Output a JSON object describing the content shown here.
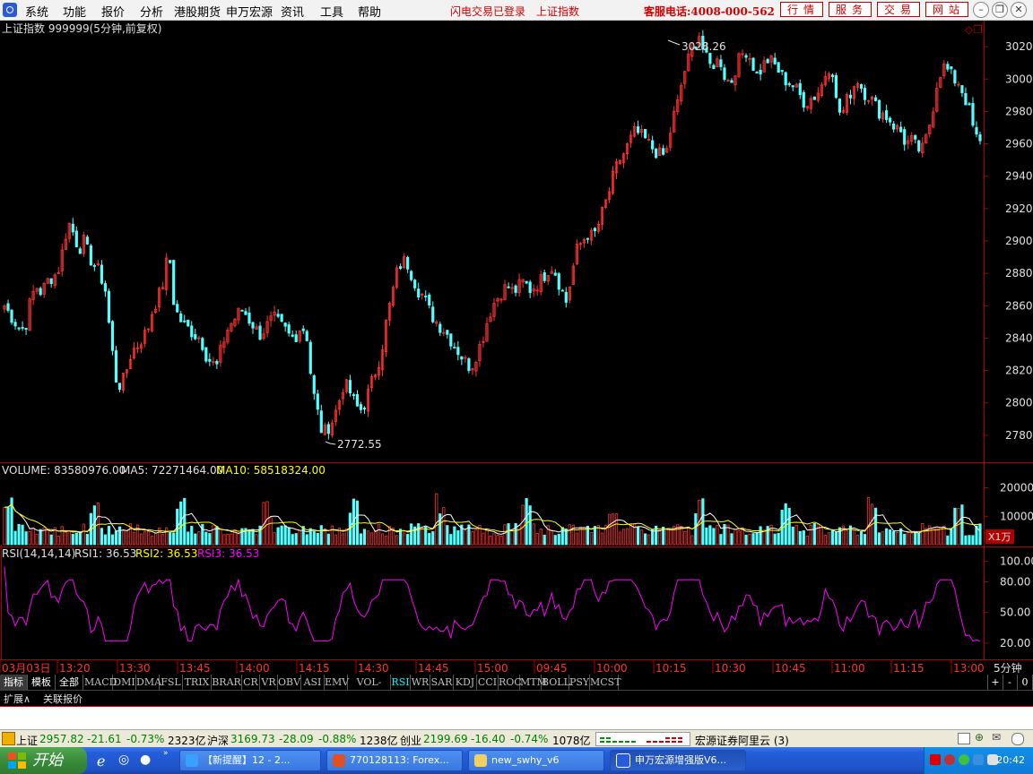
{
  "menu": {
    "items": [
      "系统",
      "功能",
      "报价",
      "分析",
      "港股期货",
      "申万宏源",
      "资讯",
      "工具",
      "帮助"
    ],
    "flash": "闪电交易已登录",
    "index_name": "上证指数",
    "hotline": "客服电话:4008-000-562",
    "right_buttons": [
      "行情",
      "服务",
      "交易",
      "网站"
    ]
  },
  "chart": {
    "header": "上证指数 999999(5分钟,前复权)",
    "high_label": "3028.26",
    "low_label": "2772.55",
    "price_ticks": [
      "3020",
      "3000",
      "2980",
      "2960",
      "2940",
      "2920",
      "2900",
      "2880",
      "2860",
      "2840",
      "2820",
      "2800",
      "2780"
    ],
    "volume_header": {
      "vol": "VOLUME: 83580976.00",
      "ma5": "MA5: 72271464.00",
      "ma10": "MA10: 58518324.00"
    },
    "volume_ticks": [
      "20000",
      "10000"
    ],
    "volume_unit": "X1万",
    "rsi_header": {
      "name": "RSI(14,14,14)",
      "rsi1": "RSI1: 36.53",
      "rsi2": "RSI2: 36.53",
      "rsi3": "RSI3: 36.53"
    },
    "rsi_ticks": [
      "100.00",
      "80.00",
      "50.00",
      "20.00"
    ],
    "time_labels": [
      "03月03日",
      "13:20",
      "13:30",
      "13:45",
      "14:00",
      "14:15",
      "14:30",
      "14:45",
      "15:00",
      "09:45",
      "10:00",
      "10:15",
      "10:30",
      "10:45",
      "11:00",
      "11:15",
      "13:00"
    ],
    "period": "5分钟",
    "colors": {
      "up": "#ff3232",
      "down": "#54ffff",
      "ma5": "#ffffff",
      "ma10": "#ffff00",
      "rsi": "#ff00ff",
      "axis": "#b00000"
    }
  },
  "chart_data": {
    "type": "candlestick",
    "title": "上证指数 999999(5分钟,前复权)",
    "y_range": [
      2765,
      3035
    ],
    "high": 3028.26,
    "low": 2772.55,
    "close_path": [
      2860,
      2855,
      2850,
      2845,
      2848,
      2865,
      2872,
      2868,
      2875,
      2878,
      2880,
      2895,
      2912,
      2905,
      2895,
      2900,
      2890,
      2885,
      2880,
      2870,
      2840,
      2815,
      2810,
      2820,
      2832,
      2835,
      2840,
      2845,
      2858,
      2865,
      2875,
      2895,
      2860,
      2852,
      2848,
      2845,
      2842,
      2840,
      2830,
      2825,
      2822,
      2835,
      2845,
      2850,
      2855,
      2858,
      2852,
      2848,
      2842,
      2845,
      2850,
      2852,
      2848,
      2845,
      2840,
      2842,
      2848,
      2842,
      2810,
      2795,
      2780,
      2785,
      2790,
      2800,
      2812,
      2808,
      2800,
      2795,
      2800,
      2810,
      2820,
      2830,
      2850,
      2865,
      2880,
      2888,
      2886,
      2878,
      2870,
      2866,
      2858,
      2852,
      2848,
      2845,
      2840,
      2835,
      2830,
      2825,
      2822,
      2830,
      2838,
      2850,
      2860,
      2865,
      2870,
      2872,
      2868,
      2872,
      2875,
      2870,
      2872,
      2875,
      2880,
      2885,
      2880,
      2870,
      2862,
      2880,
      2895,
      2900,
      2905,
      2902,
      2910,
      2920,
      2930,
      2942,
      2950,
      2955,
      2962,
      2968,
      2965,
      2962,
      2958,
      2955,
      2952,
      2956,
      2975,
      2985,
      3002,
      3012,
      3020,
      3028,
      3015,
      3008,
      3010,
      3012,
      3000,
      2998,
      3008,
      3015,
      3018,
      3010,
      3002,
      3008,
      3012,
      3010,
      3005,
      3000,
      2998,
      2995,
      2990,
      2985,
      2988,
      2990,
      2995,
      3005,
      3010,
      2982,
      2978,
      2988,
      2995,
      3000,
      2992,
      2990,
      2985,
      2980,
      2978,
      2975,
      2970,
      2968,
      2960,
      2962,
      2958,
      2955,
      2965,
      2980,
      3000,
      3008,
      3005,
      3000,
      2998,
      2990,
      2980,
      2965,
      2960
    ]
  },
  "tabs": {
    "groups": [
      "指标",
      "模板",
      "全部"
    ],
    "indicators": [
      "MACD",
      "DMI",
      "DMA",
      "FSL",
      "TRIX",
      "BRAR",
      "CR",
      "VR",
      "OBV",
      "ASI",
      "EMV",
      "VOL-TDX",
      "RSI",
      "WR",
      "SAR",
      "KDJ",
      "CCI",
      "ROC",
      "MTM",
      "BOLL",
      "PSY",
      "MCST"
    ],
    "selected": "RSI",
    "right_buttons": [
      "+",
      "-",
      "0"
    ]
  },
  "expand": {
    "toggle": "扩展∧",
    "related": "关联报价"
  },
  "status": {
    "sh": {
      "name": "上证",
      "price": "2957.82",
      "chg": "-21.61",
      "pct": "-0.73%",
      "amt": "2323亿"
    },
    "hs": {
      "name": "沪深",
      "price": "3169.73",
      "chg": "-28.09",
      "pct": "-0.88%",
      "amt": "1238亿"
    },
    "cy": {
      "name": "创业",
      "price": "2199.69",
      "chg": "-16.40",
      "pct": "-0.74%",
      "amt": "1078亿"
    },
    "server": "宏源证券阿里云 (3)"
  },
  "taskbar": {
    "start": "开始",
    "tasks": [
      "【新提醒】12 - 2...",
      "770128113: Forex...",
      "new_swhy_v6",
      "申万宏源增强版V6..."
    ],
    "clock": "20:42"
  }
}
